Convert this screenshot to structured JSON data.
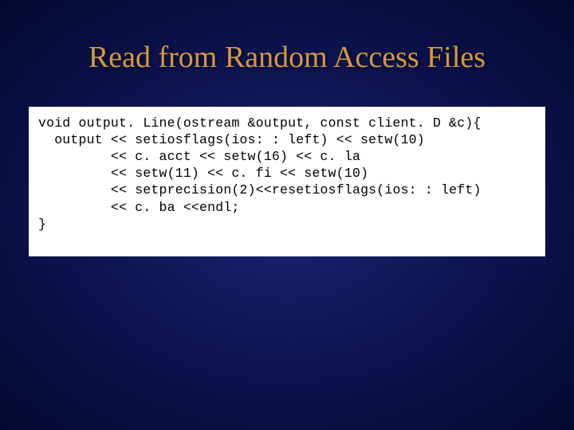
{
  "slide": {
    "title": "Read from Random Access Files",
    "code": {
      "line1": "void output. Line(ostream &output, const client. D &c){",
      "line2": "  output << setiosflags(ios: : left) << setw(10)",
      "line3": "         << c. acct << setw(16) << c. la",
      "line4": "         << setw(11) << c. fi << setw(10)",
      "line5": "         << setprecision(2)<<resetiosflags(ios: : left)",
      "line6": "         << c. ba <<endl;",
      "line7": "}"
    }
  }
}
